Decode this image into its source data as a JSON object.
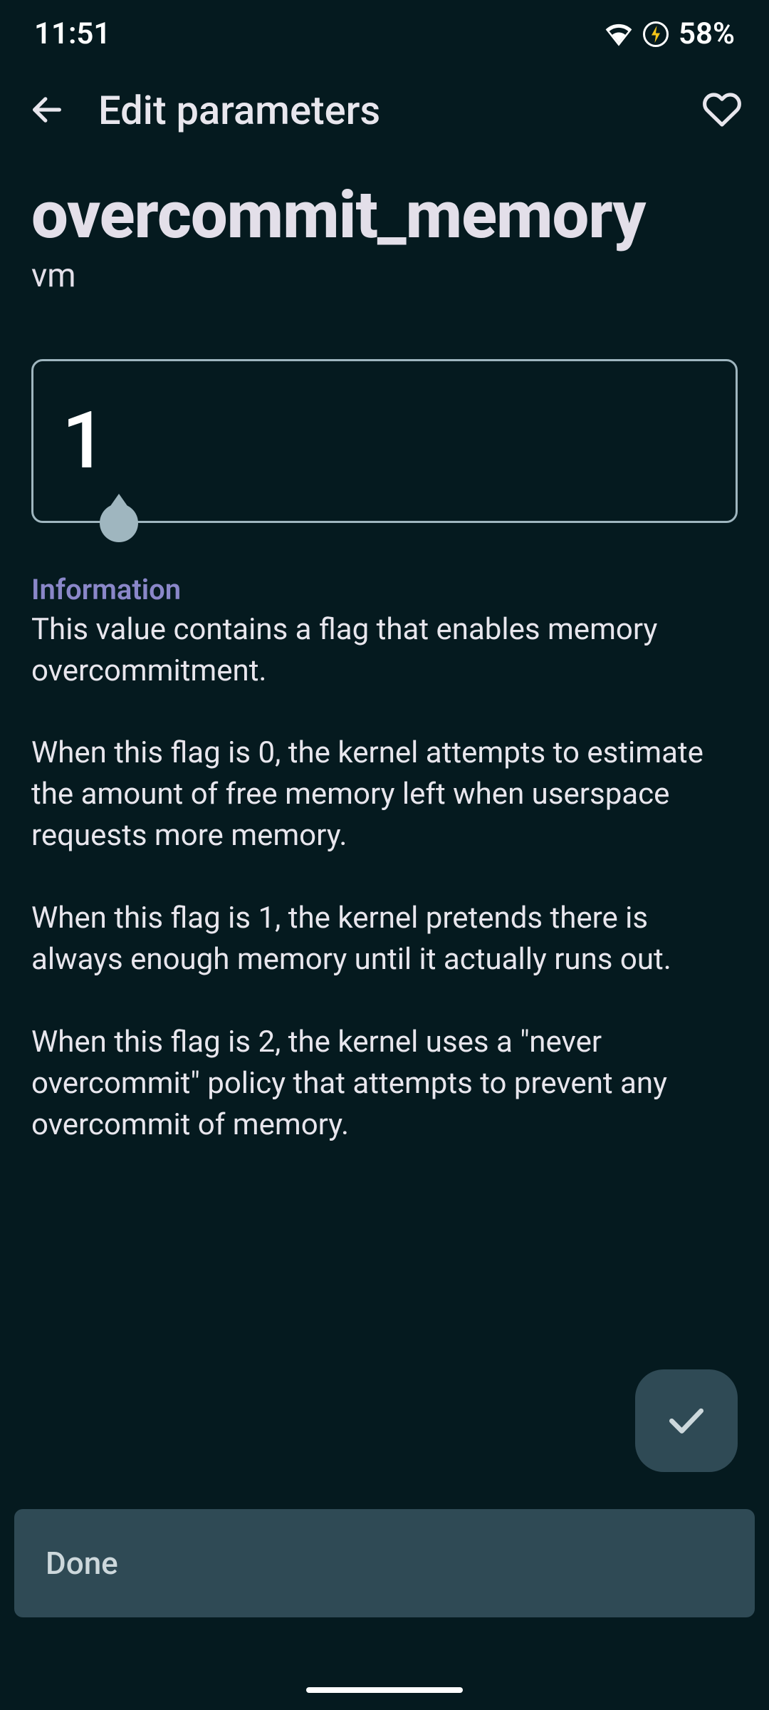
{
  "status": {
    "time": "11:51",
    "battery": "58%"
  },
  "appbar": {
    "title": "Edit parameters"
  },
  "parameter": {
    "name": "overcommit_memory",
    "category": "vm",
    "value": "1"
  },
  "info": {
    "heading": "Information",
    "body": "This value contains a flag that enables memory overcommitment.\n\nWhen this flag is 0, the kernel attempts to estimate the amount of free memory left when userspace requests more memory.\n\nWhen this flag is 1, the kernel pretends there is always enough memory until it actually runs out.\n\nWhen this flag is 2, the kernel uses a \"never overcommit\" policy that attempts to prevent any overcommit of memory."
  },
  "buttons": {
    "done": "Done"
  }
}
